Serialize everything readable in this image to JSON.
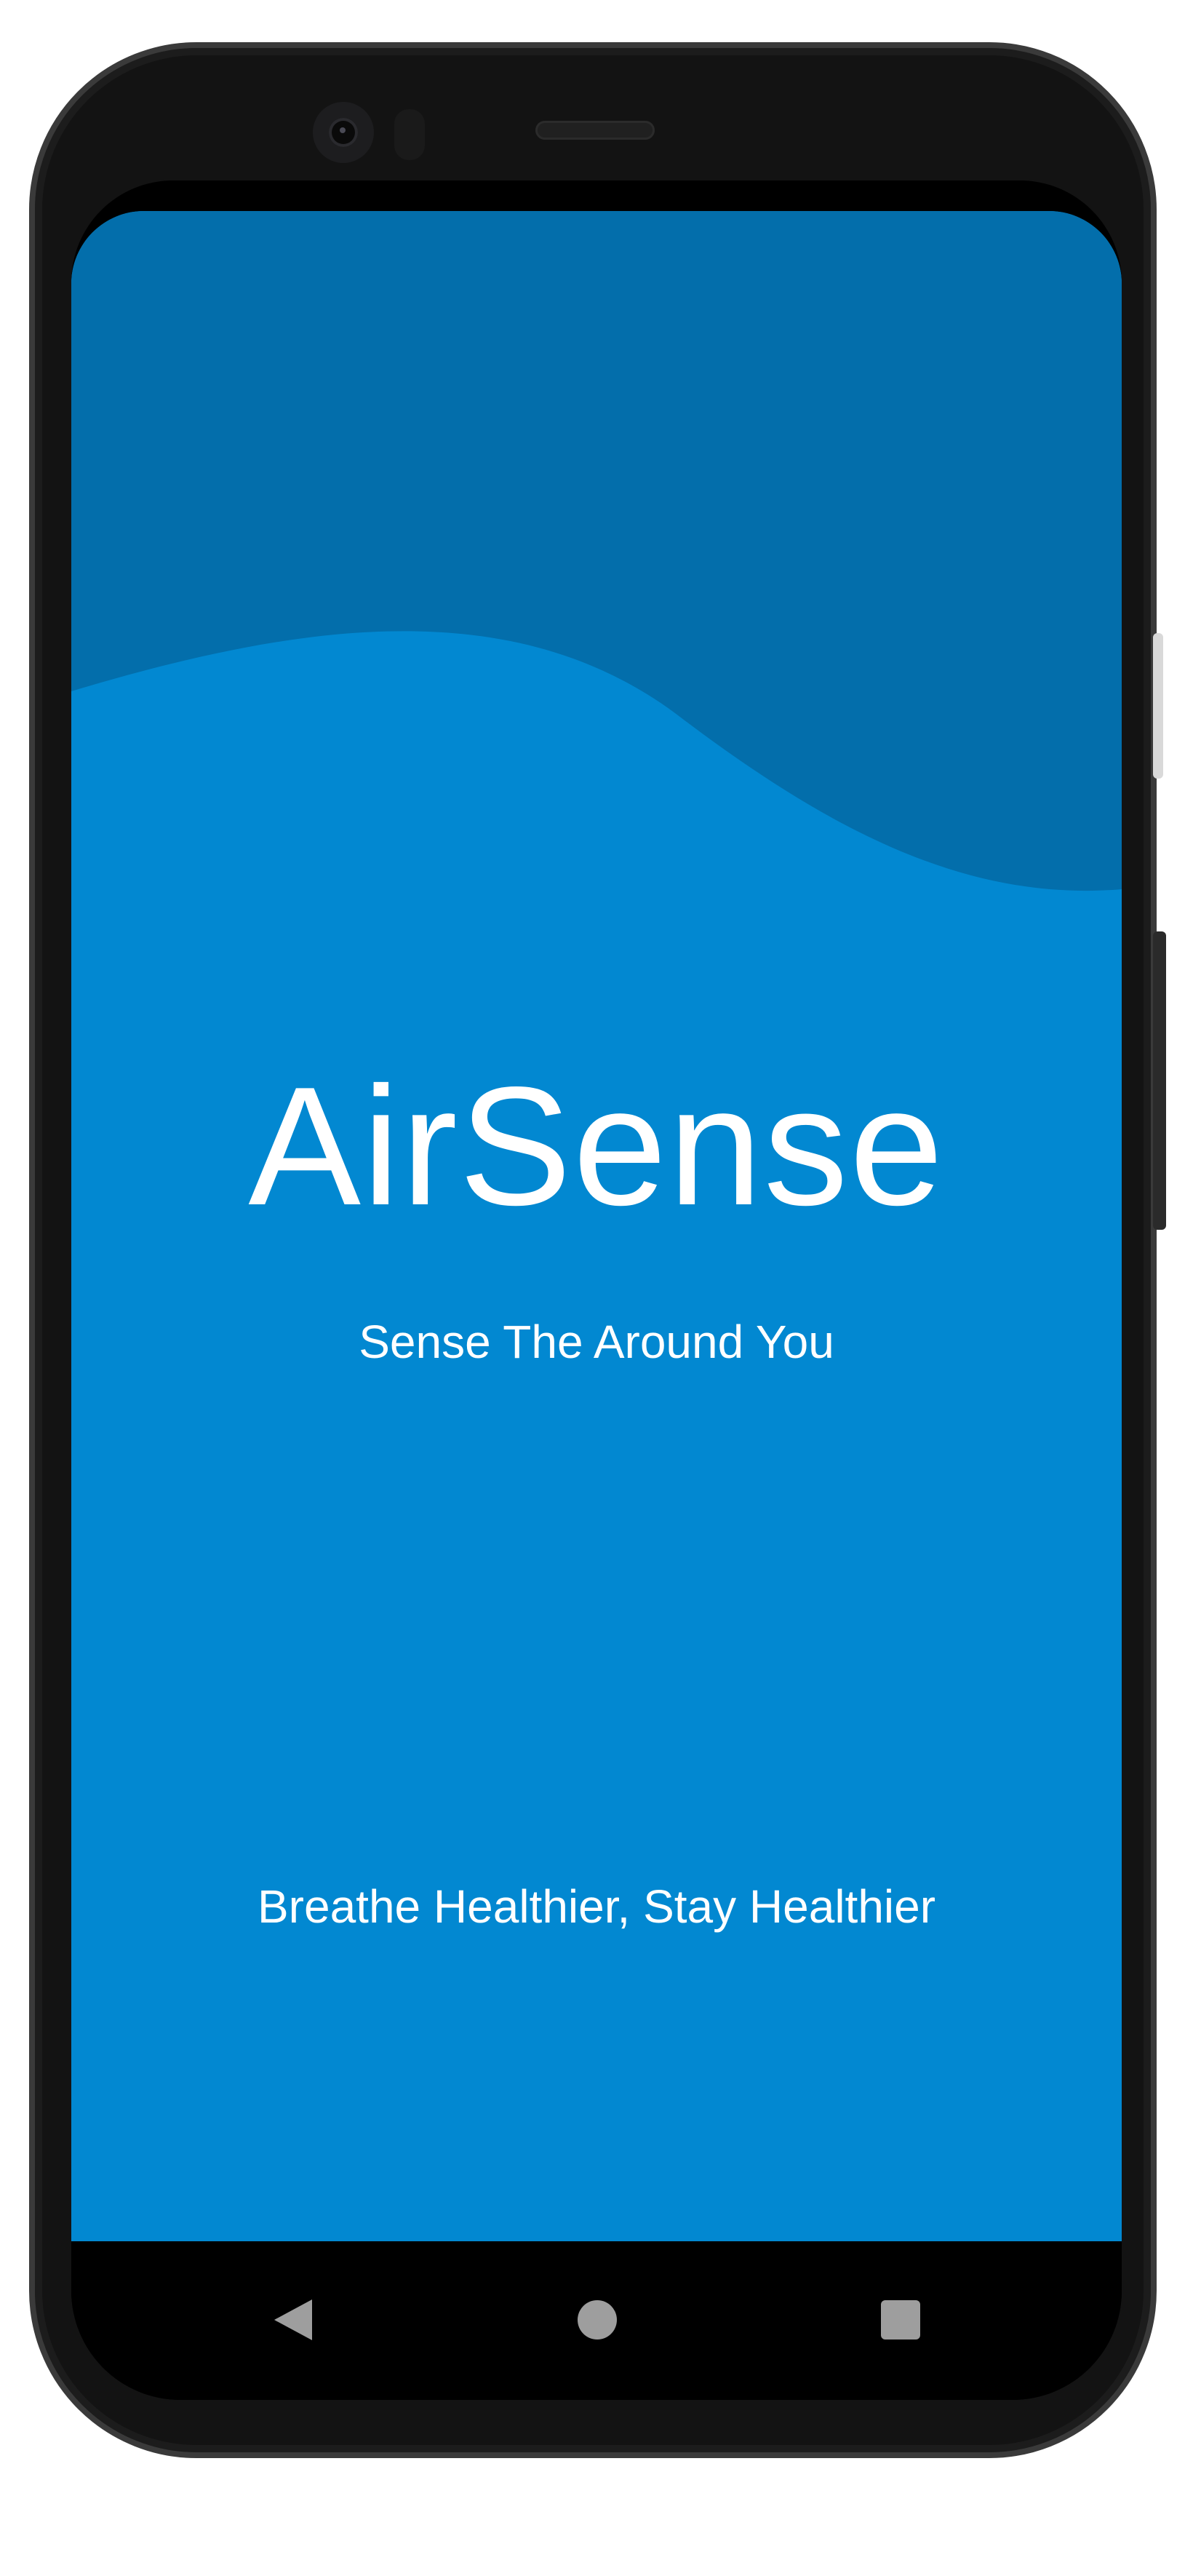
{
  "app": {
    "title": "AirSense",
    "subtitle": "Sense The Around You",
    "tagline": "Breathe Healthier, Stay Healthier"
  },
  "colors": {
    "primary": "#0288d1",
    "wave": "#036eab",
    "text": "#ffffff",
    "nav_bar": "#000000",
    "nav_icon": "#9e9e9e"
  },
  "navigation": {
    "back_icon": "back-triangle-icon",
    "home_icon": "home-circle-icon",
    "recents_icon": "recents-square-icon"
  }
}
